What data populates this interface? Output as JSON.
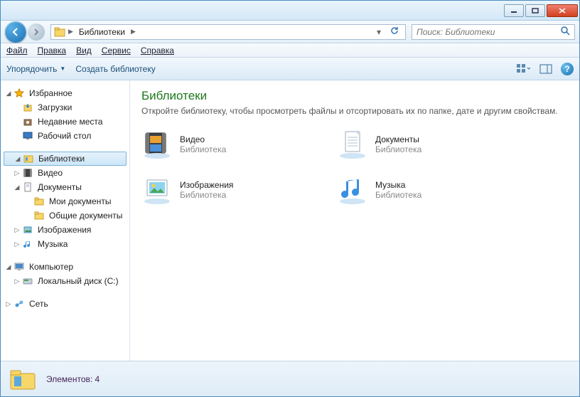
{
  "breadcrumb": {
    "root": "Библиотеки"
  },
  "search": {
    "placeholder": "Поиск: Библиотеки"
  },
  "menu": {
    "file": "Файл",
    "edit": "Правка",
    "view": "Вид",
    "tools": "Сервис",
    "help": "Справка"
  },
  "toolbar": {
    "organize": "Упорядочить",
    "create": "Создать библиотеку"
  },
  "sidebar": {
    "favorites": {
      "label": "Избранное",
      "downloads": "Загрузки",
      "recent": "Недавние места",
      "desktop": "Рабочий стол"
    },
    "libraries": {
      "label": "Библиотеки",
      "videos": "Видео",
      "documents": "Документы",
      "mydocs": "Мои документы",
      "publicdocs": "Общие документы",
      "pictures": "Изображения",
      "music": "Музыка"
    },
    "computer": {
      "label": "Компьютер",
      "localdisk": "Локальный диск (C:)"
    },
    "network": {
      "label": "Сеть"
    }
  },
  "content": {
    "title": "Библиотеки",
    "subtitle": "Откройте библиотеку, чтобы просмотреть файлы и отсортировать их по папке, дате и другим свойствам.",
    "items": [
      {
        "name": "Видео",
        "type": "Библиотека"
      },
      {
        "name": "Документы",
        "type": "Библиотека"
      },
      {
        "name": "Изображения",
        "type": "Библиотека"
      },
      {
        "name": "Музыка",
        "type": "Библиотека"
      }
    ]
  },
  "status": {
    "text": "Элементов: 4"
  }
}
